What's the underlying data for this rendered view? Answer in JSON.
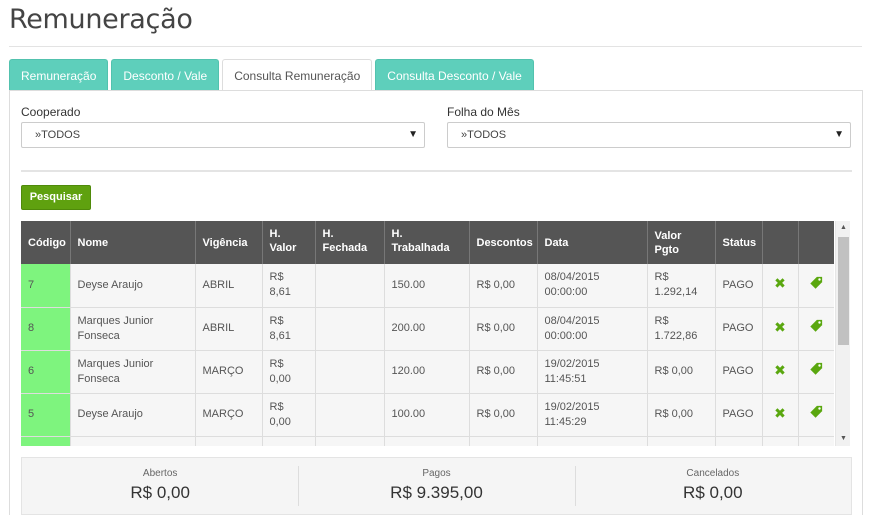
{
  "page": {
    "title": "Remuneração"
  },
  "tabs": [
    {
      "label": "Remuneração",
      "active": false
    },
    {
      "label": "Desconto / Vale",
      "active": false
    },
    {
      "label": "Consulta Remuneração",
      "active": true
    },
    {
      "label": "Consulta Desconto / Vale",
      "active": false
    }
  ],
  "filters": {
    "cooperado": {
      "label": "Cooperado",
      "value": "»TODOS"
    },
    "folha": {
      "label": "Folha do Mês",
      "value": "»TODOS"
    }
  },
  "search_button": "Pesquisar",
  "table": {
    "headers": [
      "Código",
      "Nome",
      "Vigência",
      "H. Valor",
      "H. Fechada",
      "H. Trabalhada",
      "Descontos",
      "Data",
      "Valor Pgto",
      "Status"
    ],
    "rows": [
      {
        "codigo": "7",
        "nome": "Deyse Araujo",
        "vigencia": "ABRIL",
        "h_valor": "R$ 8,61",
        "h_fechada": "",
        "h_trabalhada": "150.00",
        "descontos": "R$ 0,00",
        "data": "08/04/2015 00:00:00",
        "valor_pgto": "R$ 1.292,14",
        "status": "PAGO"
      },
      {
        "codigo": "8",
        "nome": "Marques Junior Fonseca",
        "vigencia": "ABRIL",
        "h_valor": "R$ 8,61",
        "h_fechada": "",
        "h_trabalhada": "200.00",
        "descontos": "R$ 0,00",
        "data": "08/04/2015 00:00:00",
        "valor_pgto": "R$ 1.722,86",
        "status": "PAGO"
      },
      {
        "codigo": "6",
        "nome": "Marques Junior Fonseca",
        "vigencia": "MARÇO",
        "h_valor": "R$ 0,00",
        "h_fechada": "",
        "h_trabalhada": "120.00",
        "descontos": "R$ 0,00",
        "data": "19/02/2015 11:45:51",
        "valor_pgto": "R$ 0,00",
        "status": "PAGO"
      },
      {
        "codigo": "5",
        "nome": "Deyse Araujo",
        "vigencia": "MARÇO",
        "h_valor": "R$ 0,00",
        "h_fechada": "",
        "h_trabalhada": "100.00",
        "descontos": "R$ 0,00",
        "data": "19/02/2015 11:45:29",
        "valor_pgto": "R$ 0,00",
        "status": "PAGO"
      }
    ],
    "row_icons": [
      "close-icon",
      "tag-icon"
    ]
  },
  "summary": [
    {
      "label": "Abertos",
      "value": "R$ 0,00"
    },
    {
      "label": "Pagos",
      "value": "R$ 9.395,00"
    },
    {
      "label": "Cancelados",
      "value": "R$ 0,00"
    }
  ],
  "colors": {
    "tab": "#5ecfbb",
    "button": "#5fa10f",
    "header": "#555555",
    "code_cell": "#7ef47e",
    "icon": "#5aa70f"
  }
}
